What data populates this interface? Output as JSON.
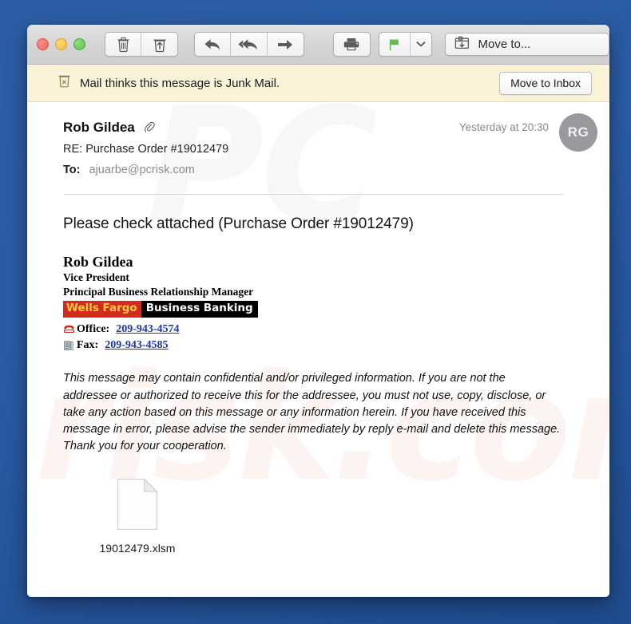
{
  "window": {
    "traffic_lights": [
      {
        "name": "close",
        "color": "#ee6a5f"
      },
      {
        "name": "minimize",
        "color": "#f3bb45"
      },
      {
        "name": "zoom",
        "color": "#5fc452"
      }
    ]
  },
  "toolbar": {
    "delete_label": "Delete",
    "junk_label": "Move to Junk",
    "reply_label": "Reply",
    "reply_all_label": "Reply All",
    "forward_label": "Forward",
    "print_label": "Print",
    "flag_label": "Flag",
    "flag_color": "#63bb50",
    "flag_menu_label": "Flag options",
    "move_to_label": "Move to..."
  },
  "junk_banner": {
    "icon": "junk-bin-icon",
    "message": "Mail thinks this message is Junk Mail.",
    "action_label": "Move to Inbox",
    "background": "#fbf3d8"
  },
  "message": {
    "sender": "Rob Gildea",
    "has_attachment_icon": "paperclip-icon",
    "subject": "RE: Purchase Order #19012479",
    "to_label": "To:",
    "to_address": "ajuarbe@pcrisk.com",
    "date": "Yesterday at 20:30",
    "avatar_initials": "RG",
    "body": {
      "title": "Please check attached (Purchase Order #19012479)",
      "signature": {
        "name": "Rob Gildea",
        "title_line_1": "Vice President",
        "title_line_2": "Principal Business Relationship Manager",
        "brand_primary": "Wells Fargo",
        "brand_primary_bg": "#d52b1e",
        "brand_primary_fg": "#ffcd41",
        "brand_secondary": "Business Banking",
        "brand_secondary_bg": "#000000",
        "brand_secondary_fg": "#ffffff",
        "office_label": "Office:",
        "office_number": "209-943-4574",
        "fax_label": "Fax:",
        "fax_number": "209-943-4585",
        "link_color": "#1c34b5"
      },
      "disclaimer": "This message may contain confidential and/or privileged information. If you are not the addressee or authorized to receive this for the addressee, you must not use, copy, disclose, or take any action based on this message or any information herein. If you have received this message in error, please advise the sender immediately by reply e-mail and delete this message. Thank you for your cooperation."
    },
    "attachment": {
      "filename": "19012479.xlsm",
      "icon": "document-file-icon"
    }
  },
  "watermark": {
    "top_text": "PC",
    "bottom_text": "risk.com"
  }
}
